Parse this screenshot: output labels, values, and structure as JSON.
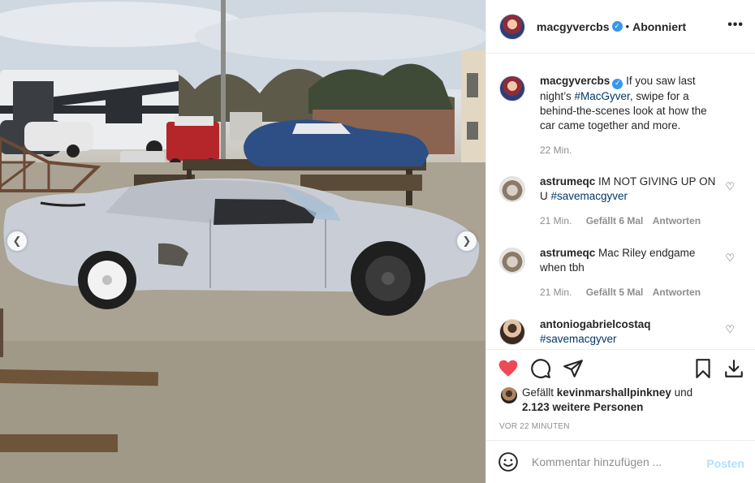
{
  "post": {
    "username": "macgyvercbs",
    "follow_status": "Abonniert",
    "caption_prefix": "If you saw last night’s ",
    "caption_tag": "#MacGyver",
    "caption_suffix": ", swipe for a behind-the-scenes look at how the car came together and more.",
    "caption_time": "22 Min."
  },
  "comments": [
    {
      "username": "astrumeqc",
      "text": "IM NOT GIVING UP ON U ",
      "tag": "#savemacgyver",
      "time": "21 Min.",
      "likes": "Gefällt 6 Mal",
      "reply": "Antworten"
    },
    {
      "username": "astrumeqc",
      "text": "Mac Riley endgame when tbh",
      "tag": "",
      "time": "21 Min.",
      "likes": "Gefällt 5 Mal",
      "reply": "Antworten"
    },
    {
      "username": "antoniogabrielcostaq",
      "text": "",
      "tag": "#savemacgyver",
      "time": "",
      "likes": "",
      "reply": ""
    }
  ],
  "likes_summary": {
    "prefix": "Gefällt",
    "user": "kevinmarshallpinkney",
    "and": "und",
    "others": "2.123 weitere Personen"
  },
  "time_ago": "VOR 22 MINUTEN",
  "comment_input": {
    "placeholder": "Kommentar hinzufügen ..."
  },
  "post_button": "Posten",
  "icons": {
    "verified": "verified-badge-icon",
    "more": "more-options-icon",
    "like": "heart-filled-icon",
    "comment": "comment-bubble-icon",
    "share": "paper-plane-icon",
    "save": "bookmark-icon",
    "download": "download-icon",
    "emoji": "emoji-icon",
    "prev": "chevron-left-icon",
    "next": "chevron-right-icon"
  },
  "colors": {
    "like_red": "#ed4956",
    "tag_blue": "#00376b",
    "verified_blue": "#3897f0",
    "post_disabled": "#b2dffc"
  }
}
